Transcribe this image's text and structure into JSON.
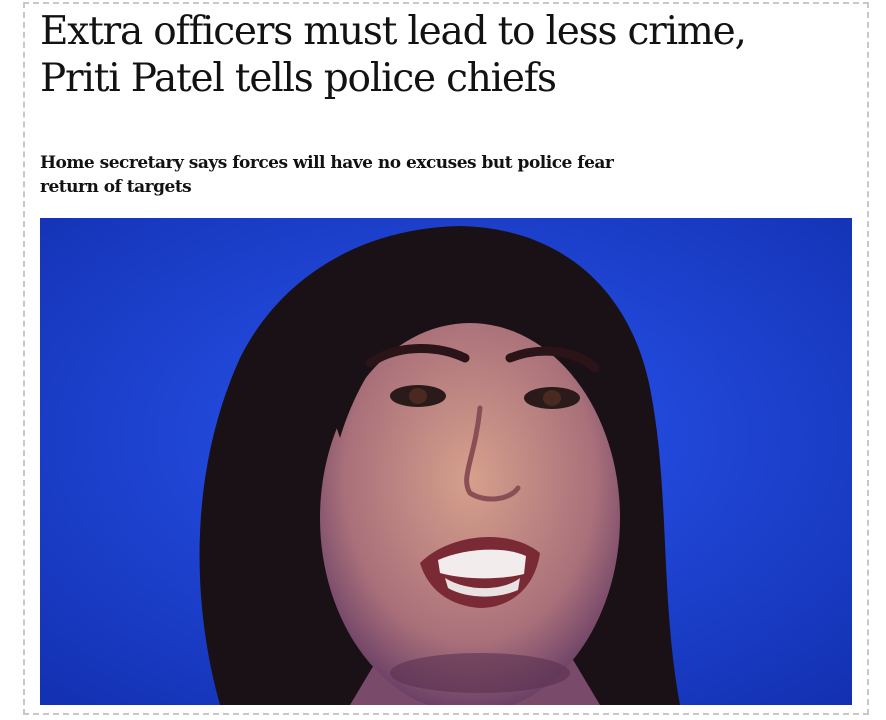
{
  "article": {
    "headline_line1": "Extra officers must lead to less crime,",
    "headline_line2": "Priti Patel tells police chiefs",
    "standfirst_line1": "Home secretary says forces will have no excuses but police fear",
    "standfirst_line2": "return of targets"
  },
  "photo": {
    "subject": "portrait-photo",
    "background_color": "#1d3fd0"
  }
}
